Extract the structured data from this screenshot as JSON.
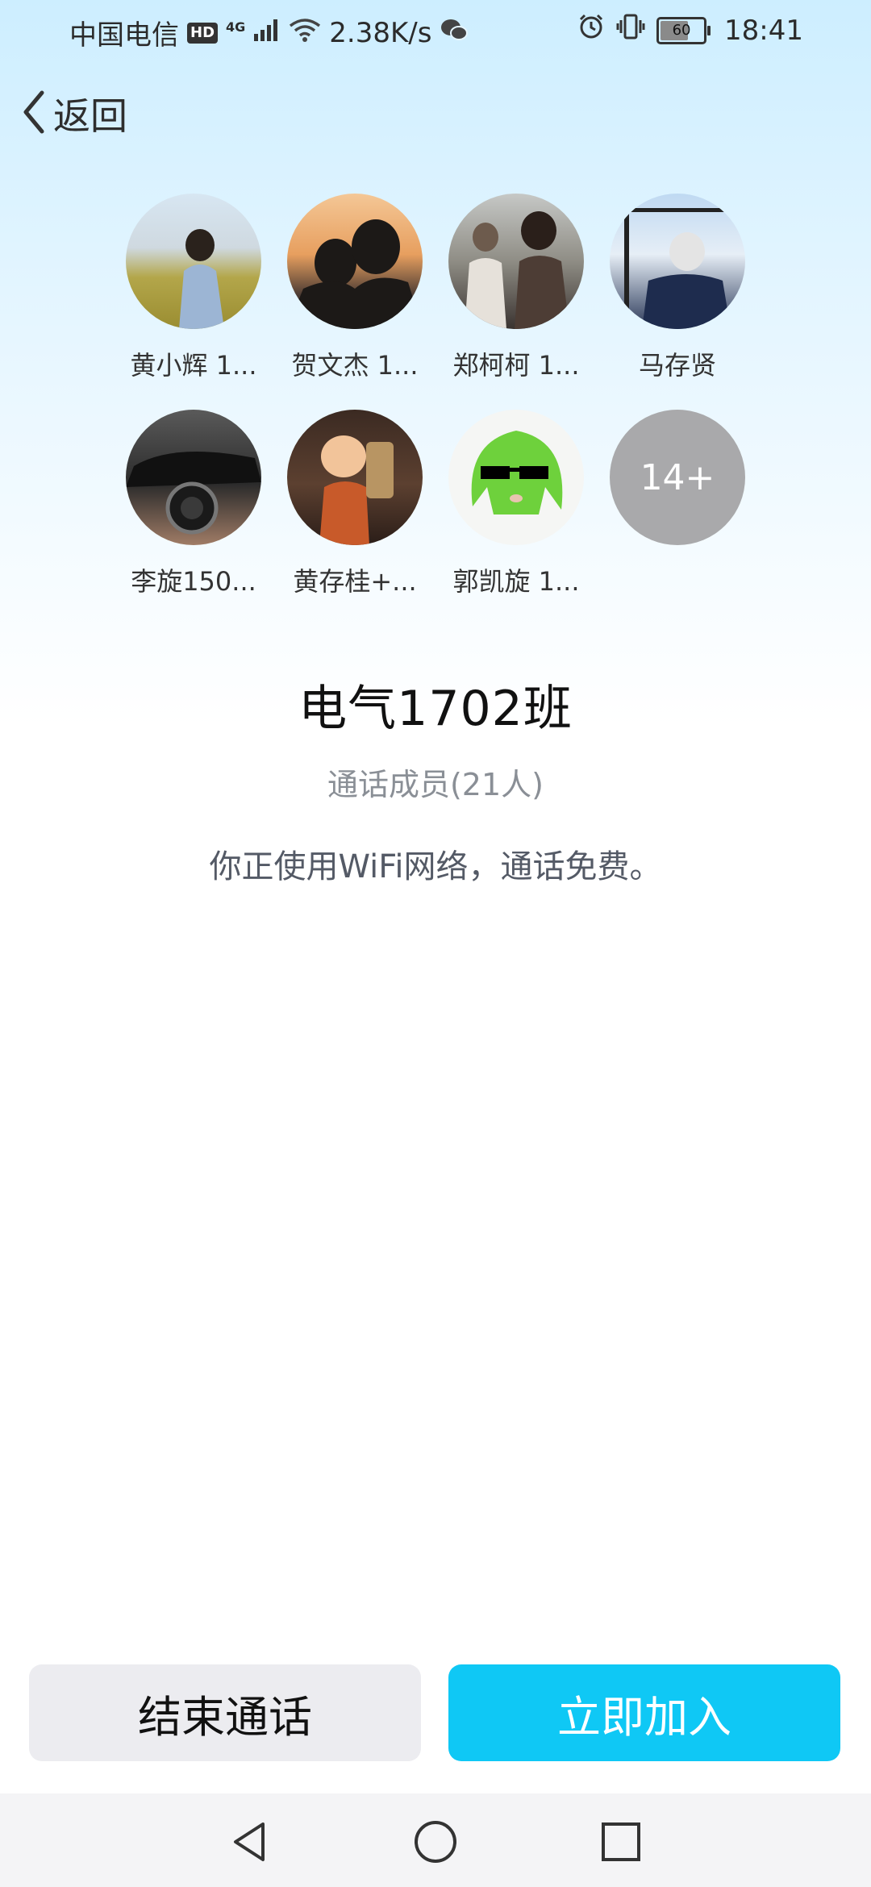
{
  "status_bar": {
    "carrier": "中国电信",
    "hd": "HD",
    "network": "4G",
    "speed": "2.38K/s",
    "battery": "60",
    "time": "18:41"
  },
  "header": {
    "back_label": "返回"
  },
  "members": [
    {
      "name": "黄小辉 1..."
    },
    {
      "name": "贺文杰 1..."
    },
    {
      "name": "郑柯柯 1..."
    },
    {
      "name": "马存贤"
    },
    {
      "name": "李旋150..."
    },
    {
      "name": "黄存桂+..."
    },
    {
      "name": "郭凯旋 1..."
    }
  ],
  "more_members": "14+",
  "group": {
    "title": "电气1702班",
    "count": "通话成员(21人)",
    "wifi_note": "你正使用WiFi网络，通话免费。"
  },
  "actions": {
    "end_label": "结束通话",
    "join_label": "立即加入"
  },
  "colors": {
    "join_button": "#0fc8f5",
    "end_button": "#ececf0",
    "more_circle": "#a9a9ab"
  }
}
